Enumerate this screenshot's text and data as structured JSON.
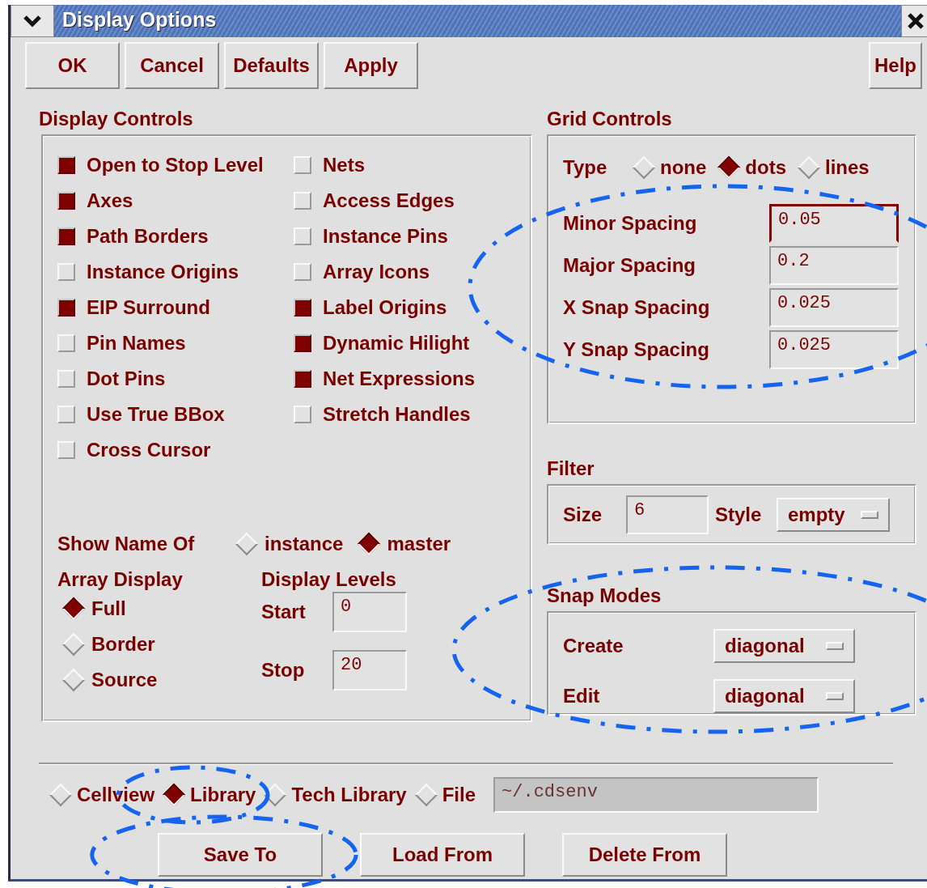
{
  "window": {
    "title": "Display Options"
  },
  "toolbar": {
    "buttons": [
      "OK",
      "Cancel",
      "Defaults",
      "Apply"
    ],
    "help": "Help"
  },
  "display_controls": {
    "title": "Display Controls",
    "columns": [
      {
        "options": [
          {
            "label": "Open to Stop Level",
            "checked": true
          },
          {
            "label": "Axes",
            "checked": true
          },
          {
            "label": "Path Borders",
            "checked": true
          },
          {
            "label": "Instance Origins",
            "checked": false
          },
          {
            "label": "EIP Surround",
            "checked": true
          },
          {
            "label": "Pin Names",
            "checked": false
          },
          {
            "label": "Dot Pins",
            "checked": false
          },
          {
            "label": "Use True BBox",
            "checked": false
          },
          {
            "label": "Cross Cursor",
            "checked": false
          }
        ]
      },
      {
        "options": [
          {
            "label": "Nets",
            "checked": false
          },
          {
            "label": "Access Edges",
            "checked": false
          },
          {
            "label": "Instance Pins",
            "checked": false
          },
          {
            "label": "Array Icons",
            "checked": false
          },
          {
            "label": "Label Origins",
            "checked": true
          },
          {
            "label": "Dynamic Hilight",
            "checked": true
          },
          {
            "label": "Net Expressions",
            "checked": true
          },
          {
            "label": "Stretch Handles",
            "checked": false
          }
        ]
      }
    ],
    "show_name_of": {
      "label": "Show Name Of",
      "choices": [
        {
          "label": "instance",
          "selected": false
        },
        {
          "label": "master",
          "selected": true
        }
      ]
    },
    "array_display": {
      "title": "Array Display",
      "choices": [
        {
          "label": "Full",
          "selected": true
        },
        {
          "label": "Border",
          "selected": false
        },
        {
          "label": "Source",
          "selected": false
        }
      ]
    },
    "display_levels": {
      "title": "Display Levels",
      "fields": [
        {
          "label": "Start",
          "value": "0"
        },
        {
          "label": "Stop",
          "value": "20"
        }
      ]
    }
  },
  "grid_controls": {
    "title": "Grid Controls",
    "annotated": true,
    "type": {
      "label": "Type",
      "choices": [
        {
          "label": "none",
          "selected": false
        },
        {
          "label": "dots",
          "selected": true
        },
        {
          "label": "lines",
          "selected": false
        }
      ]
    },
    "fields": [
      {
        "label": "Minor Spacing",
        "value": "0.05",
        "focused": true
      },
      {
        "label": "Major Spacing",
        "value": "0.2",
        "focused": false
      },
      {
        "label": "X Snap Spacing",
        "value": "0.025",
        "focused": false
      },
      {
        "label": "Y Snap Spacing",
        "value": "0.025",
        "focused": false
      }
    ]
  },
  "filter": {
    "title": "Filter",
    "size": {
      "label": "Size",
      "value": "6"
    },
    "style": {
      "label": "Style",
      "value": "empty"
    }
  },
  "snap_modes": {
    "title": "Snap Modes",
    "annotated": true,
    "fields": [
      {
        "label": "Create",
        "value": "diagonal"
      },
      {
        "label": "Edit",
        "value": "diagonal"
      }
    ]
  },
  "save_scope": {
    "choices": [
      {
        "label": "Cellview",
        "selected": false
      },
      {
        "label": "Library",
        "selected": true,
        "annotated": true
      },
      {
        "label": "Tech Library",
        "selected": false
      },
      {
        "label": "File",
        "selected": false
      }
    ],
    "file": {
      "value": "~/.cdsenv",
      "disabled": true
    }
  },
  "actions": [
    {
      "label": "Save To",
      "annotated": true
    },
    {
      "label": "Load From"
    },
    {
      "label": "Delete From"
    }
  ]
}
